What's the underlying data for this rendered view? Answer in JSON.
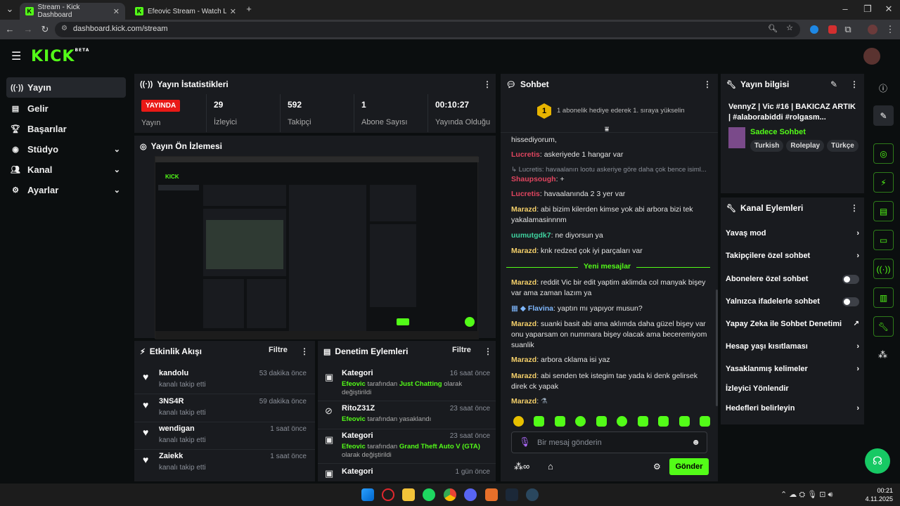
{
  "browser": {
    "tabs": [
      {
        "title": "Stream - Kick Dashboard"
      },
      {
        "title": "Efeovic Stream - Watch Live on"
      }
    ],
    "url": "dashboard.kick.com/stream"
  },
  "header": {
    "logo": "KICK",
    "logo_sup": "BETA"
  },
  "sidebar": {
    "items": [
      {
        "label": "Yayın",
        "icon": "broadcast-icon"
      },
      {
        "label": "Gelir",
        "icon": "revenue-icon"
      },
      {
        "label": "Başarılar",
        "icon": "trophy-icon"
      },
      {
        "label": "Stüdyo",
        "icon": "studio-icon"
      },
      {
        "label": "Kanal",
        "icon": "channel-icon"
      },
      {
        "label": "Ayarlar",
        "icon": "gear-icon"
      }
    ]
  },
  "stats": {
    "title": "Yayın İstatistikleri",
    "items": [
      {
        "value": "YAYINDA",
        "label": "Yayın"
      },
      {
        "value": "29",
        "label": "İzleyici"
      },
      {
        "value": "592",
        "label": "Takipçi"
      },
      {
        "value": "1",
        "label": "Abone Sayısı"
      },
      {
        "value": "00:10:27",
        "label": "Yayında Olduğu"
      }
    ]
  },
  "preview": {
    "title": "Yayın Ön İzlemesi"
  },
  "activity": {
    "title": "Etkinlik Akışı",
    "filter": "Filtre",
    "items": [
      {
        "user": "kandolu",
        "text": "kanalı takip etti",
        "time": "53 dakika önce"
      },
      {
        "user": "3NS4R",
        "text": "kanalı takip etti",
        "time": "59 dakika önce"
      },
      {
        "user": "wendigan",
        "text": "kanalı takip etti",
        "time": "1 saat önce"
      },
      {
        "user": "Zaiekk",
        "text": "kanalı takip etti",
        "time": "1 saat önce"
      }
    ]
  },
  "moderation": {
    "title": "Denetim Eylemleri",
    "filter": "Filtre",
    "items": [
      {
        "title": "Kategori",
        "time": "16 saat önce",
        "actor": "Efeovic",
        "mid": "tarafından",
        "target": "Just Chatting",
        "rest": "olarak",
        "line2": "değiştirildi"
      },
      {
        "title": "RitoZ31Z",
        "time": "23 saat önce",
        "actor": "Efeovic",
        "mid": "tarafından yasaklandı",
        "target": "",
        "rest": "",
        "line2": ""
      },
      {
        "title": "Kategori",
        "time": "23 saat önce",
        "actor": "Efeovic",
        "mid": "tarafından",
        "target": "Grand Theft Auto V (GTA)",
        "rest": "",
        "line2": "olarak değiştirildi"
      },
      {
        "title": "Kategori",
        "time": "1 gün önce",
        "actor": "",
        "mid": "",
        "target": "",
        "rest": "",
        "line2": ""
      }
    ]
  },
  "chat": {
    "title": "Sohbet",
    "banner": "1 abonelik hediye ederek 1. sıraya yükselin",
    "banner_badge": "1",
    "messages": [
      {
        "user": "",
        "color": "#e4e4e4",
        "text": "hissediyorum,"
      },
      {
        "user": "Lucretis",
        "color": "#e0455f",
        "text": "askeriyede 1 hangar var"
      },
      {
        "user": "",
        "color": "#8a8f98",
        "text": "Lucretis: havaalanın lootu askeriye göre daha çok bence isiml..."
      },
      {
        "user": "Shaupsough",
        "color": "#e0455f",
        "text": "+"
      },
      {
        "user": "Lucretis",
        "color": "#e0455f",
        "text": "havaalanında 2 3 yer var"
      },
      {
        "user": "Marazd",
        "color": "#f5d06a",
        "text": "abi bizim kilerden kimse yok abi arbora bizi tek yakalamasinnnm"
      },
      {
        "user": "uumutgdk7",
        "color": "#3fd3a0",
        "text": "ne diyorsun ya"
      },
      {
        "user": "Marazd",
        "color": "#f5d06a",
        "text": "knk redzed çok iyi parçaları var"
      },
      {
        "user": "Marazd",
        "color": "#f5d06a",
        "text": "reddit Vic bir edit yaptim aklimda col manyak bişey var ama zaman lazım ya"
      },
      {
        "user": "Flavina",
        "color": "#7fb8ff",
        "text": "yaptın mı yapıyor musun?"
      },
      {
        "user": "Marazd",
        "color": "#f5d06a",
        "text": "suanki basit abi ama aklımda daha güzel bişey var onu yaparsam on nummara bişey olacak ama beceremiyom suanlik"
      },
      {
        "user": "Marazd",
        "color": "#f5d06a",
        "text": "arbora cklama isi yaz"
      },
      {
        "user": "Marazd",
        "color": "#f5d06a",
        "text": "abi senden tek istegim tae yada ki denk gelirsek direk ck yapak"
      },
      {
        "user": "Marazd",
        "color": "#f5d06a",
        "text": ""
      }
    ],
    "new_messages": "Yeni mesajlar",
    "placeholder": "Bir mesaj gönderin",
    "send": "Gönder"
  },
  "stream_info": {
    "title": "Yayın bilgisi",
    "stream_title": "VennyZ | Vic #16 | BAKICAZ ARTIK | #alaborabiddi #rolgasm...",
    "category": "Sadece Sohbet",
    "tags": [
      "Turkish",
      "Roleplay",
      "Türkçe"
    ]
  },
  "channel_actions": {
    "title": "Kanal Eylemleri",
    "items": [
      {
        "label": "Yavaş mod",
        "control": "chevron"
      },
      {
        "label": "Takipçilere özel sohbet",
        "control": "chevron"
      },
      {
        "label": "Abonelere özel sohbet",
        "control": "toggle"
      },
      {
        "label": "Yalnızca ifadelerle sohbet",
        "control": "toggle"
      },
      {
        "label": "Yapay Zeka ile Sohbet Denetimi",
        "control": "external"
      },
      {
        "label": "Hesap yaşı kısıtlaması",
        "control": "chevron"
      },
      {
        "label": "Yasaklanmış kelimeler",
        "control": "chevron"
      },
      {
        "label": "İzleyici Yönlendir",
        "control": "none"
      },
      {
        "label": "Hedefleri belirleyin",
        "control": "chevron"
      }
    ]
  },
  "taskbar": {
    "time": "00:21",
    "date": "4.11.2025"
  },
  "colors": {
    "accent": "#53fc18",
    "live": "#e91916",
    "panel": "#191b1f",
    "bg": "#0b0e0f"
  }
}
